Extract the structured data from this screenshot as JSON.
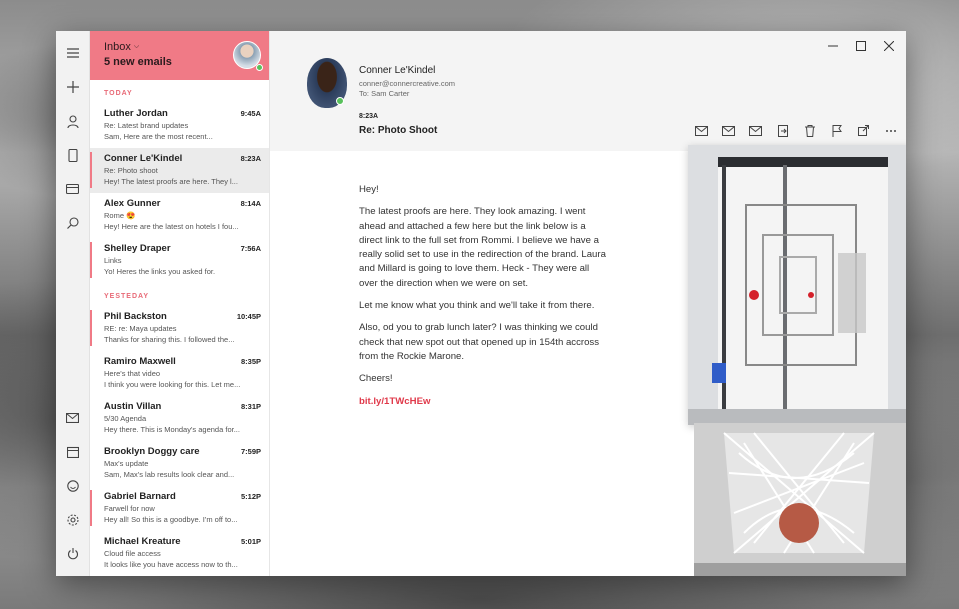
{
  "rail": {
    "top_icons": [
      "menu-icon",
      "plus-icon",
      "person-icon",
      "phone-icon",
      "card-icon",
      "search-icon"
    ],
    "bottom_icons": [
      "mail-icon",
      "calendar-icon",
      "smiley-icon",
      "settings-icon",
      "power-icon"
    ]
  },
  "list": {
    "folder": "Inbox",
    "count_label": "5 new emails",
    "sections": [
      {
        "label": "TODAY",
        "items": [
          {
            "sender": "Luther Jordan",
            "time": "9:45A",
            "subject": "Re: Latest brand updates",
            "preview": "Sam, Here are the most recent...",
            "flagged": false,
            "selected": false
          },
          {
            "sender": "Conner Le'Kindel",
            "time": "8:23A",
            "subject": "Re: Photo shoot",
            "preview": "Hey! The latest proofs are here. They l...",
            "flagged": true,
            "selected": true
          },
          {
            "sender": "Alex Gunner",
            "time": "8:14A",
            "subject": "Rome 😍",
            "preview": "Hey! Here are the latest on hotels I fou...",
            "flagged": false,
            "selected": false
          },
          {
            "sender": "Shelley Draper",
            "time": "7:56A",
            "subject": "Links",
            "preview": "Yo! Heres the links you asked for.",
            "flagged": true,
            "selected": false
          }
        ]
      },
      {
        "label": "YESTEDAY",
        "items": [
          {
            "sender": "Phil Backston",
            "time": "10:45P",
            "subject": "RE: re: Maya updates",
            "preview": "Thanks for sharing this. I followed the...",
            "flagged": true,
            "selected": false
          },
          {
            "sender": "Ramiro Maxwell",
            "time": "8:35P",
            "subject": "Here's that video",
            "preview": "I think you were looking for this. Let me...",
            "flagged": false,
            "selected": false
          },
          {
            "sender": "Austin Villan",
            "time": "8:31P",
            "subject": "5/30 Agenda",
            "preview": "Hey there. This is Monday's agenda for...",
            "flagged": false,
            "selected": false
          },
          {
            "sender": "Brooklyn Doggy care",
            "time": "7:59P",
            "subject": "Max's update",
            "preview": "Sam, Max's lab results look clear and...",
            "flagged": false,
            "selected": false
          },
          {
            "sender": "Gabriel Barnard",
            "time": "5:12P",
            "subject": "Farwell for now",
            "preview": "Hey all! So this is a goodbye. I'm off to...",
            "flagged": true,
            "selected": false
          },
          {
            "sender": "Michael Kreature",
            "time": "5:01P",
            "subject": "Cloud file access",
            "preview": "It looks like you have access now to th...",
            "flagged": false,
            "selected": false
          }
        ]
      }
    ]
  },
  "message": {
    "sender_name": "Conner Le'Kindel",
    "sender_email": "conner@connercreative.com",
    "to": "To: Sam Carter",
    "time": "8:23A",
    "subject": "Re: Photo Shoot",
    "paragraphs": [
      "Hey!",
      "The latest proofs are here. They look amazing. I went ahead and attached a few here but the link below is a direct link to the full set from Rommi. I believe we have a really solid set to use in the redirection of the brand. Laura and Millard is going to love them. Heck - They were all over the direction when we were on set.",
      "Let me know what you think and we'll take it from there.",
      "Also, od you to grab lunch later? I was thinking we could check that new spot out that opened up in 154th accross from the Rockie Marone.",
      "Cheers!"
    ],
    "link": "bit.ly/1TWcHEw"
  },
  "toolbar_icons": [
    "reply-icon",
    "reply-all-icon",
    "forward-icon",
    "move-icon",
    "delete-icon",
    "flag-icon",
    "popout-icon",
    "more-icon"
  ],
  "colors": {
    "accent": "#f07a86",
    "link": "#e0394a",
    "online": "#58c05b"
  }
}
